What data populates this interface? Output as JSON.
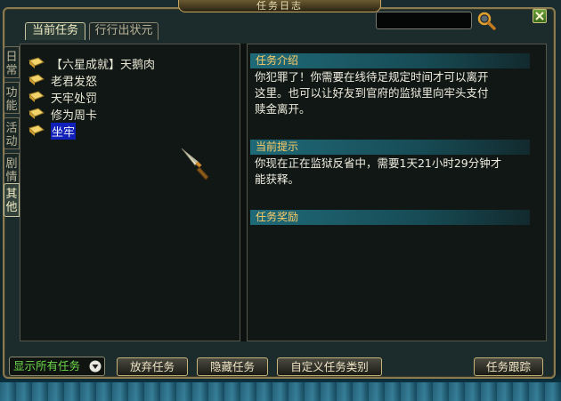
{
  "window": {
    "title": "任务日志"
  },
  "search": {
    "value": "",
    "placeholder": ""
  },
  "tabs": [
    {
      "label": "当前任务",
      "active": true
    },
    {
      "label": "行行出状元",
      "active": false
    }
  ],
  "side_tabs": [
    {
      "label": "日常",
      "active": false
    },
    {
      "label": "功能",
      "active": false
    },
    {
      "label": "活动",
      "active": false
    },
    {
      "label": "剧情",
      "active": false
    },
    {
      "label": "其他",
      "active": true
    }
  ],
  "tasks": [
    {
      "label": "【六星成就】天鹅肉",
      "selected": false
    },
    {
      "label": "老君发怒",
      "selected": false
    },
    {
      "label": "天牢处罚",
      "selected": false
    },
    {
      "label": "修为周卡",
      "selected": false
    },
    {
      "label": "坐牢",
      "selected": true
    }
  ],
  "detail": {
    "intro_head": "任务介绍",
    "intro_lines": [
      "你犯罪了！你需要在线待足规定时间才可以离开",
      "这里。也可以让好友到官府的监狱里向牢头支付",
      "赎金离开。"
    ],
    "hint_head": "当前提示",
    "hint_lines": [
      "你现在正在监狱反省中，需要1天21小时29分钟才",
      "能获释。"
    ],
    "reward_head": "任务奖励"
  },
  "footer": {
    "filter_label": "显示所有任务",
    "abandon": "放弃任务",
    "hide": "隐藏任务",
    "custom": "自定义任务类别",
    "track": "任务跟踪"
  },
  "colors": {
    "frame_gold": "#8a7a50",
    "section_header_text": "#ffcc66",
    "selected_bg": "#1020b8",
    "filter_green": "#6cd84a"
  },
  "icons": {
    "task_item": "scroll-icon",
    "search": "magnifier-icon",
    "close": "close-icon",
    "cursor": "dagger-cursor-icon"
  }
}
